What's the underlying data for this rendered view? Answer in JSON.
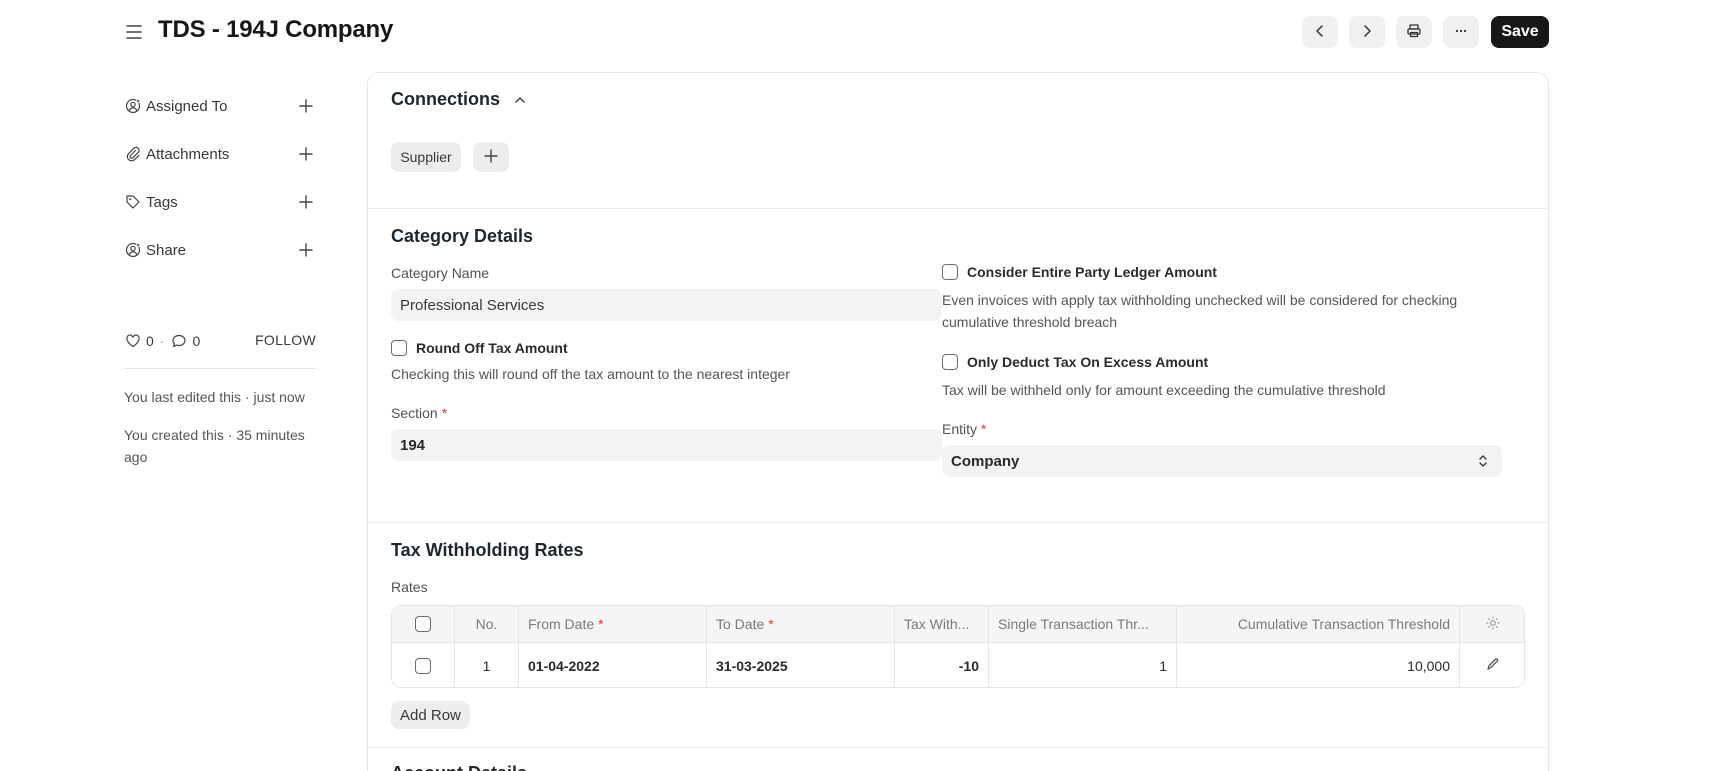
{
  "header": {
    "title": "TDS - 194J Company",
    "save_label": "Save"
  },
  "sidebar": {
    "items": [
      {
        "label": "Assigned To",
        "icon": "assign-user-icon"
      },
      {
        "label": "Attachments",
        "icon": "paperclip-icon"
      },
      {
        "label": "Tags",
        "icon": "tag-icon"
      },
      {
        "label": "Share",
        "icon": "share-user-icon"
      }
    ],
    "likes": "0",
    "separator": "·",
    "comments": "0",
    "follow_label": "FOLLOW",
    "timeline": [
      "You last edited this · just now",
      "You created this · 35 minutes ago"
    ]
  },
  "connections": {
    "title": "Connections",
    "links": [
      "Supplier"
    ]
  },
  "category": {
    "title": "Category Details",
    "name_label": "Category Name",
    "name_value": "Professional Services",
    "round_off_label": "Round Off Tax Amount",
    "round_off_help": "Checking this will round off the tax amount to the nearest integer",
    "section_label": "Section",
    "section_value": "194",
    "consider_label": "Consider Entire Party Ledger Amount",
    "consider_help": "Even invoices with apply tax withholding unchecked will be considered for checking cumulative threshold breach",
    "excess_label": "Only Deduct Tax On Excess Amount",
    "excess_help": "Tax will be withheld only for amount exceeding the cumulative threshold",
    "entity_label": "Entity",
    "entity_value": "Company",
    "required_mark": "*"
  },
  "rates": {
    "title": "Tax Withholding Rates",
    "table_label": "Rates",
    "columns": [
      "No.",
      "From Date",
      "To Date",
      "Tax With...",
      "Single Transaction Thr...",
      "Cumulative Transaction Threshold"
    ],
    "rows": [
      {
        "no": "1",
        "from": "01-04-2022",
        "to": "31-03-2025",
        "tax": "-10",
        "single": "1",
        "cumulative": "10,000"
      }
    ],
    "add_row_label": "Add Row"
  },
  "account": {
    "title": "Account Details"
  }
}
